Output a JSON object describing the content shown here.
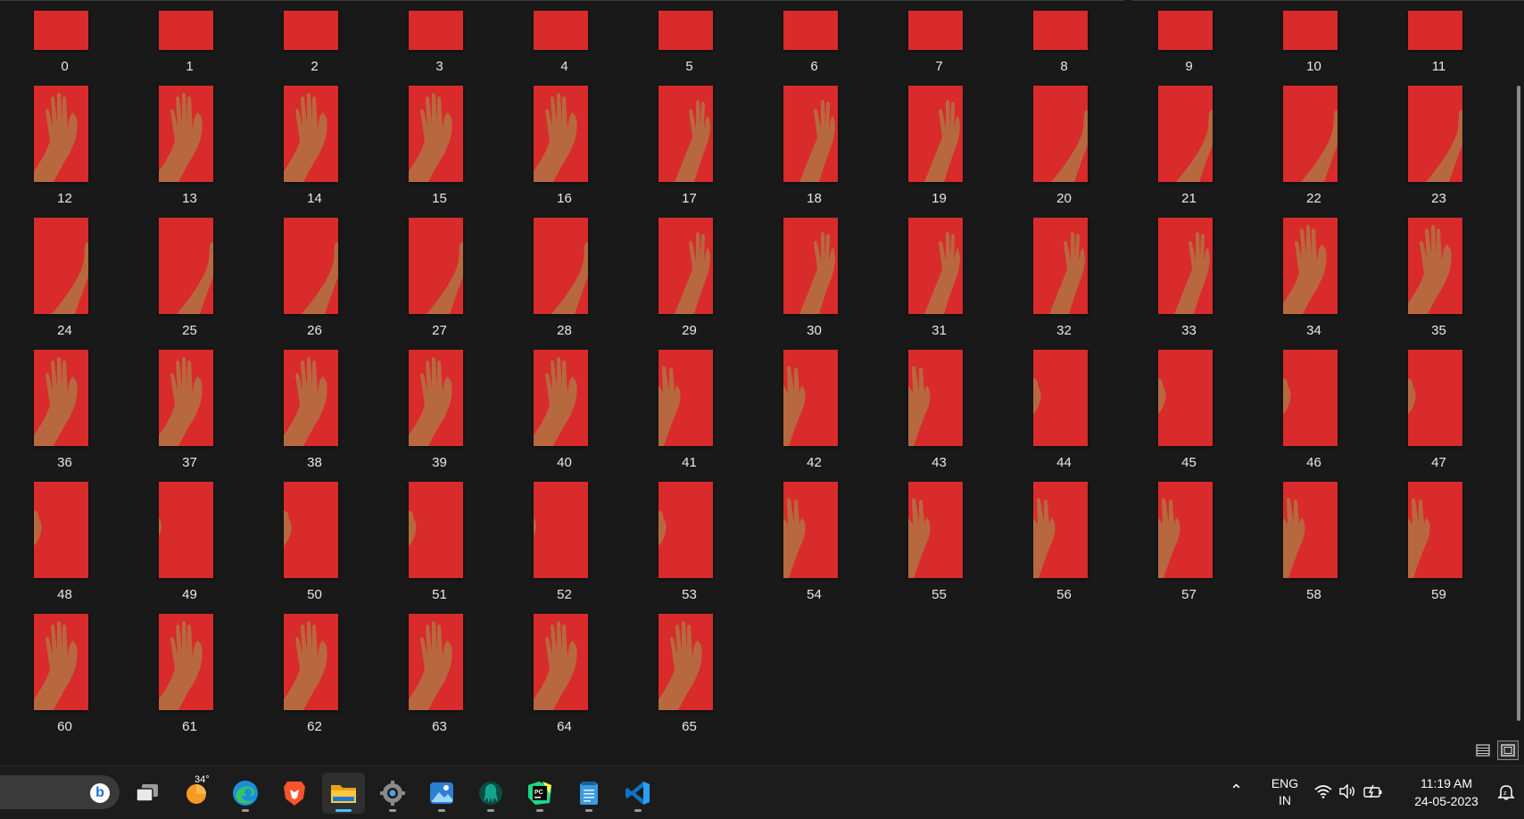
{
  "explorer": {
    "files": [
      {
        "name": "0",
        "hand": 0
      },
      {
        "name": "1",
        "hand": 0
      },
      {
        "name": "2",
        "hand": 0
      },
      {
        "name": "3",
        "hand": 0
      },
      {
        "name": "4",
        "hand": 0
      },
      {
        "name": "5",
        "hand": 0
      },
      {
        "name": "6",
        "hand": 0
      },
      {
        "name": "7",
        "hand": 0
      },
      {
        "name": "8",
        "hand": 0
      },
      {
        "name": "9",
        "hand": 0
      },
      {
        "name": "10",
        "hand": 0
      },
      {
        "name": "11",
        "hand": 0
      },
      {
        "name": "12",
        "hand": 1
      },
      {
        "name": "13",
        "hand": 1
      },
      {
        "name": "14",
        "hand": 1
      },
      {
        "name": "15",
        "hand": 1
      },
      {
        "name": "16",
        "hand": 1
      },
      {
        "name": "17",
        "hand": 2
      },
      {
        "name": "18",
        "hand": 2
      },
      {
        "name": "19",
        "hand": 2
      },
      {
        "name": "20",
        "hand": 3
      },
      {
        "name": "21",
        "hand": 3
      },
      {
        "name": "22",
        "hand": 3
      },
      {
        "name": "23",
        "hand": 3
      },
      {
        "name": "24",
        "hand": 3
      },
      {
        "name": "25",
        "hand": 3
      },
      {
        "name": "26",
        "hand": 3
      },
      {
        "name": "27",
        "hand": 3
      },
      {
        "name": "28",
        "hand": 3
      },
      {
        "name": "29",
        "hand": 2
      },
      {
        "name": "30",
        "hand": 2
      },
      {
        "name": "31",
        "hand": 2
      },
      {
        "name": "32",
        "hand": 2
      },
      {
        "name": "33",
        "hand": 2
      },
      {
        "name": "34",
        "hand": 1
      },
      {
        "name": "35",
        "hand": 1
      },
      {
        "name": "36",
        "hand": 1
      },
      {
        "name": "37",
        "hand": 1
      },
      {
        "name": "38",
        "hand": 1
      },
      {
        "name": "39",
        "hand": 1
      },
      {
        "name": "40",
        "hand": 1
      },
      {
        "name": "41",
        "hand": 4
      },
      {
        "name": "42",
        "hand": 4
      },
      {
        "name": "43",
        "hand": 4
      },
      {
        "name": "44",
        "hand": 5
      },
      {
        "name": "45",
        "hand": 5
      },
      {
        "name": "46",
        "hand": 5
      },
      {
        "name": "47",
        "hand": 5
      },
      {
        "name": "48",
        "hand": 5
      },
      {
        "name": "49",
        "hand": 6
      },
      {
        "name": "50",
        "hand": 5
      },
      {
        "name": "51",
        "hand": 5
      },
      {
        "name": "52",
        "hand": 6
      },
      {
        "name": "53",
        "hand": 5
      },
      {
        "name": "54",
        "hand": 4
      },
      {
        "name": "55",
        "hand": 4
      },
      {
        "name": "56",
        "hand": 4
      },
      {
        "name": "57",
        "hand": 4
      },
      {
        "name": "58",
        "hand": 4
      },
      {
        "name": "59",
        "hand": 4
      },
      {
        "name": "60",
        "hand": 1
      },
      {
        "name": "61",
        "hand": 1
      },
      {
        "name": "62",
        "hand": 1
      },
      {
        "name": "63",
        "hand": 1
      },
      {
        "name": "64",
        "hand": 1
      },
      {
        "name": "65",
        "hand": 1
      }
    ],
    "view_modes": [
      {
        "name": "details-view-button",
        "icon": "details-view-icon",
        "active": false
      },
      {
        "name": "large-icons-view-button",
        "icon": "large-icons-view-icon",
        "active": true
      }
    ]
  },
  "taskbar": {
    "weather_temp": "34°",
    "apps": [
      {
        "name": "task-view",
        "icon": "task-view-icon",
        "running": false,
        "active": false
      },
      {
        "name": "weather",
        "icon": "weather-sun-icon",
        "running": false,
        "active": false
      },
      {
        "name": "edge",
        "icon": "edge-browser-icon",
        "running": true,
        "active": false
      },
      {
        "name": "brave",
        "icon": "brave-lion-icon",
        "running": false,
        "active": false
      },
      {
        "name": "file-explorer",
        "icon": "folder-icon",
        "running": true,
        "active": true
      },
      {
        "name": "settings",
        "icon": "gear-icon",
        "running": true,
        "active": false
      },
      {
        "name": "photos",
        "icon": "photos-icon",
        "running": true,
        "active": false
      },
      {
        "name": "gitkraken",
        "icon": "gitkraken-icon",
        "running": true,
        "active": false
      },
      {
        "name": "pycharm",
        "icon": "pycharm-icon",
        "running": true,
        "active": false
      },
      {
        "name": "notepad",
        "icon": "notepad-icon",
        "running": true,
        "active": false
      },
      {
        "name": "vscode",
        "icon": "vscode-icon",
        "running": true,
        "active": false
      }
    ],
    "tray": {
      "language_top": "ENG",
      "language_bottom": "IN",
      "time": "11:19 AM",
      "date": "24-05-2023"
    }
  },
  "colors": {
    "background": "#191919",
    "thumb_red": "#d92b2b",
    "skin": "#b8683f",
    "accent": "#4cc2ff"
  }
}
